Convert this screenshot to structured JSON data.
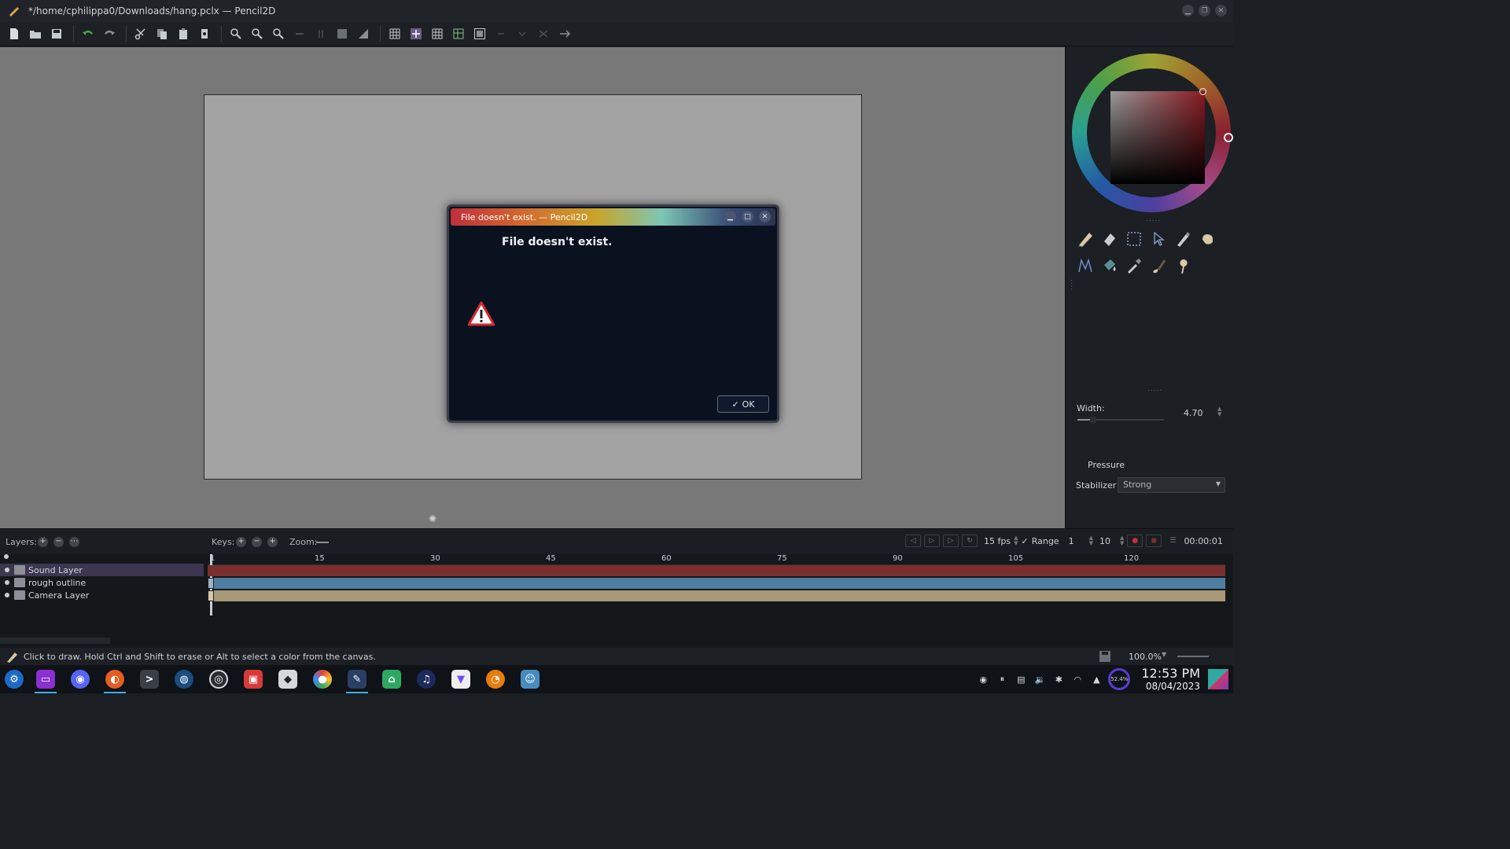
{
  "window": {
    "title": "*/home/cphilippa0/Downloads/hang.pclx — Pencil2D",
    "controls": [
      "minimize",
      "maximize",
      "close"
    ]
  },
  "toolbar": {
    "icons": [
      "new-file-icon",
      "open-file-icon",
      "save-icon",
      "undo-icon",
      "redo-icon",
      "cut-icon",
      "copy-icon",
      "paste-icon",
      "clear-icon",
      "zoom-in-icon",
      "zoom-out-icon",
      "zoom-reset-icon",
      "rotate-left-icon",
      "rotate-right-icon",
      "flip-h-icon",
      "flip-v-icon",
      "grid-icon",
      "center-icon",
      "thirds-icon",
      "golden-icon",
      "safe-area-icon",
      "onion-prev-icon",
      "onion-next-icon",
      "onion-both-icon",
      "more-icon"
    ]
  },
  "right_panel": {
    "width_label": "Width:",
    "width_value": "4.70",
    "pressure_label": "Pressure",
    "stabilizer_label": "Stabilizer",
    "stabilizer_value": "Strong",
    "tools": [
      "pencil-icon",
      "eraser-icon",
      "select-icon",
      "move-icon",
      "pen-icon",
      "hand-icon",
      "polyline-icon",
      "bucket-icon",
      "eyedropper-icon",
      "brush-icon",
      "smudge-icon"
    ]
  },
  "timeline": {
    "layers_label": "Layers:",
    "keys_label": "Keys:",
    "zoom_label": "Zoom:",
    "fps": "15 fps",
    "range_check": "✓",
    "range_label": "Range",
    "range_start": "1",
    "range_end": "10",
    "time": "00:00:01",
    "ruler_numbers": [
      "1",
      "15",
      "30",
      "45",
      "60",
      "75",
      "90",
      "105",
      "120"
    ],
    "layers": [
      {
        "name": "Sound Layer",
        "active": true
      },
      {
        "name": "rough outline",
        "active": false
      },
      {
        "name": "Camera Layer",
        "active": false
      }
    ],
    "track_colors": [
      "#7a2e2e",
      "#4e7ea0",
      "#a79978"
    ]
  },
  "status": {
    "hint": "Click to draw. Hold Ctrl and Shift to erase or Alt to select a color from the canvas.",
    "zoom": "100.0%"
  },
  "dialog": {
    "title": "File doesn't exist. — Pencil2D",
    "message": "File doesn't exist.",
    "ok_label": "OK"
  },
  "taskbar": {
    "apps": [
      "launcher-icon",
      "files-icon",
      "discord-icon",
      "firefox-icon",
      "terminal-icon",
      "steam-icon",
      "obs-icon",
      "game-icon",
      "roblox-icon",
      "browser-icon",
      "pencil2d-icon",
      "store-icon",
      "audio-icon",
      "proton-vpn-icon",
      "blender-icon",
      "godot-icon"
    ],
    "battery": "52.4%",
    "time": "12:53 PM",
    "date": "08/04/2023"
  }
}
